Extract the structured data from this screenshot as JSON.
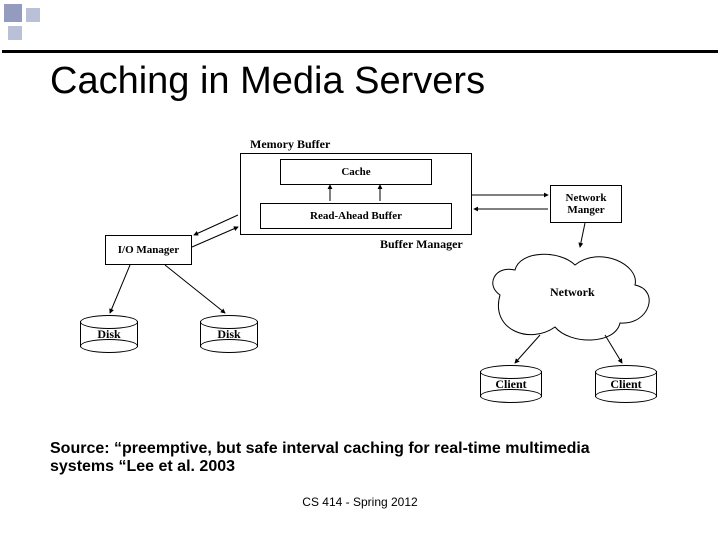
{
  "title": "Caching in Media Servers",
  "diagram": {
    "memory_buffer_label": "Memory Buffer",
    "cache_label": "Cache",
    "read_ahead_label": "Read-Ahead Buffer",
    "buffer_manager_label": "Buffer Manager",
    "io_manager_label": "I/O Manager",
    "network_manager_label": "Network Manger",
    "disk1_label": "Disk",
    "disk2_label": "Disk",
    "network_label": "Network",
    "client1_label": "Client",
    "client2_label": "Client"
  },
  "source_text": "Source:  “preemptive, but safe interval caching  for real-time multimedia systems “Lee et al. 2003",
  "footer_text": "CS 414 - Spring 2012"
}
